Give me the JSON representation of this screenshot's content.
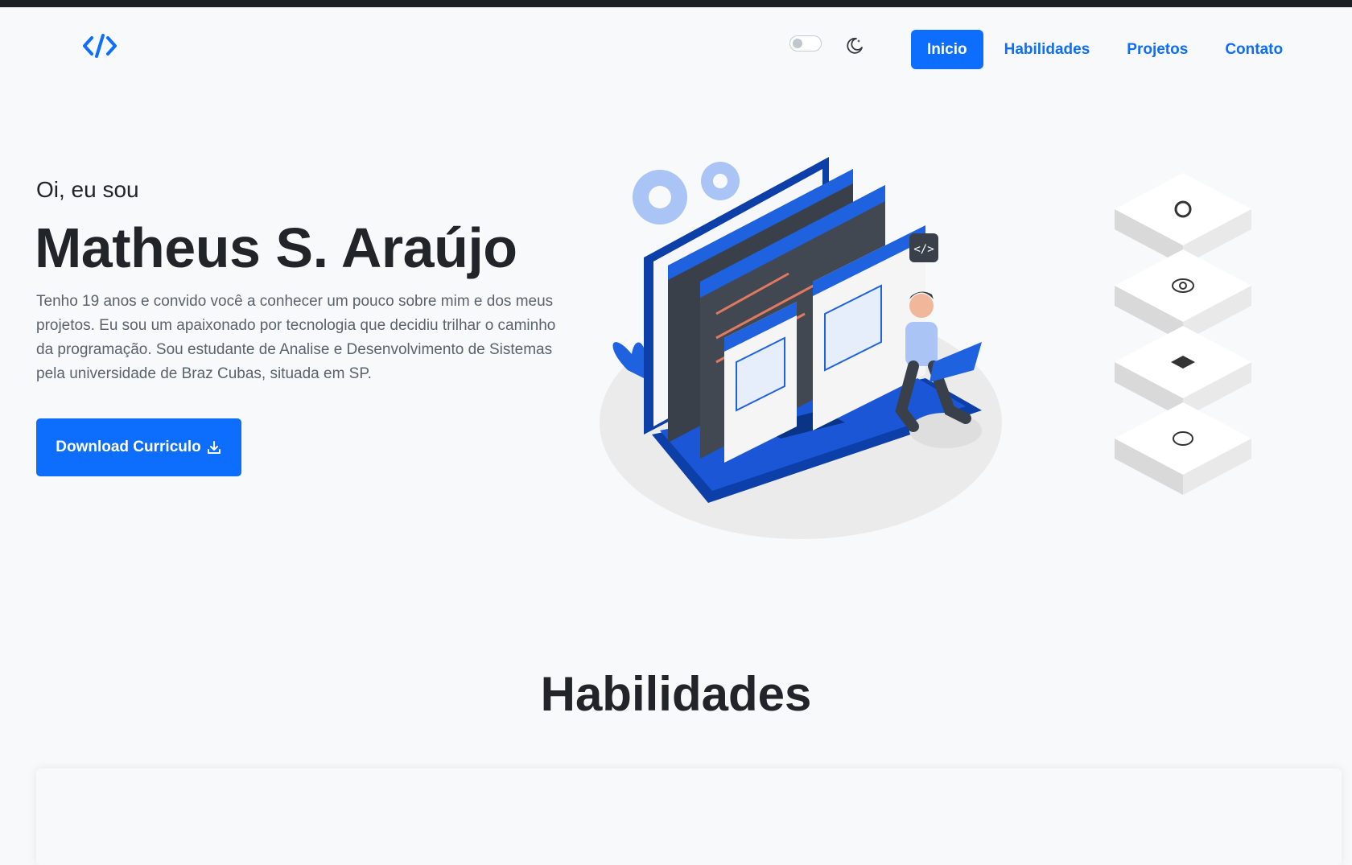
{
  "nav": {
    "links": [
      {
        "label": "Inicio",
        "active": true
      },
      {
        "label": "Habilidades",
        "active": false
      },
      {
        "label": "Projetos",
        "active": false
      },
      {
        "label": "Contato",
        "active": false
      }
    ]
  },
  "hero": {
    "greeting": "Oi, eu sou",
    "name": "Matheus S. Araújo",
    "description": "Tenho 19 anos e convido você a conhecer um pouco sobre mim e dos meus projetos. Eu sou um apaixonado por tecnologia que decidiu trilhar o caminho da programação. Sou estudante de Analise e Desenvolvimento de Sistemas pela universidade de Braz Cubas, situada em SP.",
    "download_label": "Download Curriculo"
  },
  "social_icons": [
    "github-icon",
    "instagram-icon",
    "linkedin-icon",
    "whatsapp-icon"
  ],
  "sections": {
    "skills_title": "Habilidades"
  },
  "colors": {
    "primary": "#0d6efd",
    "background": "#f8f9fb",
    "text": "#212529",
    "muted": "#5a636d"
  }
}
